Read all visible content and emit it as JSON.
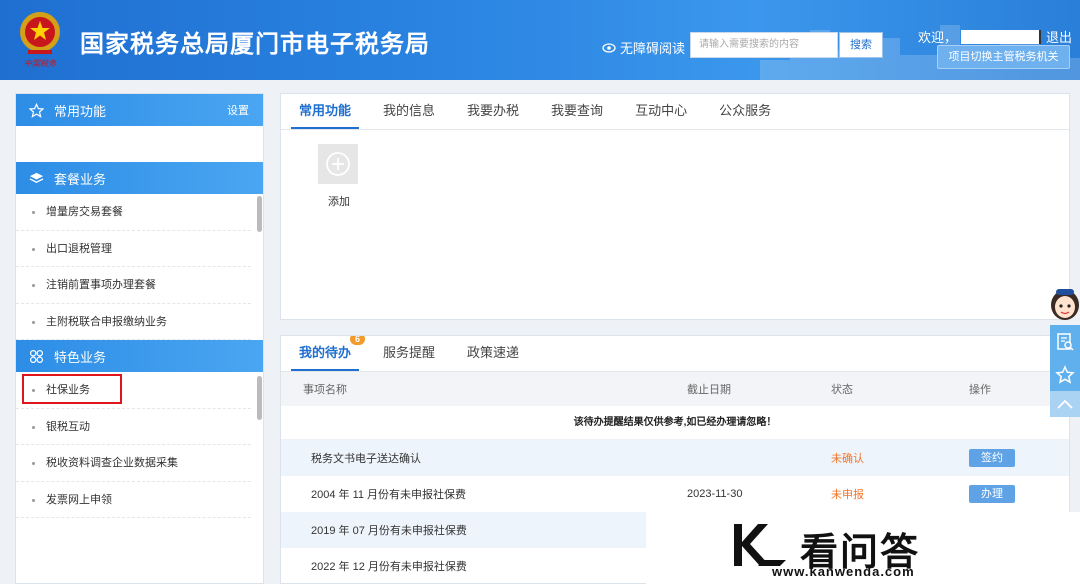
{
  "header": {
    "title": "国家税务总局厦门市电子税务局",
    "a11y_label": "无障碍阅读",
    "search_placeholder": "请输入需要搜索的内容",
    "search_button": "搜索",
    "welcome": "欢迎，",
    "logout": "退出",
    "switch_button": "项目切换主管税务机关"
  },
  "sidebar": {
    "common": {
      "title": "常用功能",
      "settings": "设置"
    },
    "package": {
      "title": "套餐业务",
      "items": [
        "增量房交易套餐",
        "出口退税管理",
        "注销前置事项办理套餐",
        "主附税联合申报缴纳业务"
      ]
    },
    "special": {
      "title": "特色业务",
      "items": [
        "社保业务",
        "银税互动",
        "税收资料调查企业数据采集",
        "发票网上申领"
      ]
    }
  },
  "main_tabs": [
    "常用功能",
    "我的信息",
    "我要办税",
    "我要查询",
    "互动中心",
    "公众服务"
  ],
  "add_label": "添加",
  "todo": {
    "tabs": [
      "我的待办",
      "服务提醒",
      "政策速递"
    ],
    "badge": "6",
    "columns": [
      "事项名称",
      "截止日期",
      "状态",
      "操作"
    ],
    "notice": "该待办提醒结果仅供参考,如已经办理请忽略！",
    "rows": [
      {
        "name": "税务文书电子送达确认",
        "date": "",
        "status": "未确认",
        "action": "签约"
      },
      {
        "name": "2004 年 11 月份有未申报社保费",
        "date": "2023-11-30",
        "status": "未申报",
        "action": "办理"
      },
      {
        "name": "2019 年 07 月份有未申报社保费",
        "date": "",
        "status": "",
        "action": ""
      },
      {
        "name": "2022 年 12 月份有未申报社保费",
        "date": "",
        "status": "",
        "action": ""
      }
    ]
  },
  "watermark": {
    "text": "看问答",
    "url": "www.kanwenda.com"
  },
  "colors": {
    "primary": "#1f6fd1",
    "header_blue": "#2c86e3",
    "status_orange": "#f0752a",
    "badge_orange": "#f39a2c",
    "highlight_red": "#e0141b"
  }
}
